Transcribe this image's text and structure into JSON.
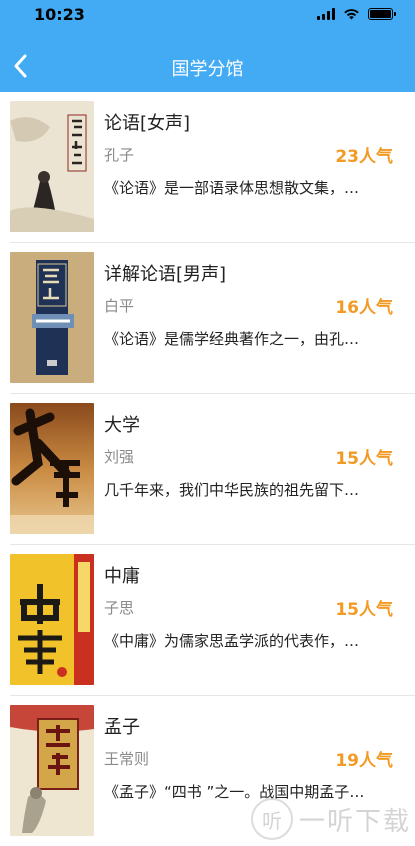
{
  "status_bar": {
    "time": "10:23"
  },
  "nav": {
    "title": "国学分馆",
    "back_icon": "chevron-left-icon"
  },
  "colors": {
    "header": "#42abf3",
    "popularity": "#f39a24",
    "author": "#8a8a8a"
  },
  "books": [
    {
      "title": "论语[女声]",
      "author": "孔子",
      "popularity": "23人气",
      "description": "《论语》是一部语录体思想散文集，主要记载孔子及其弟子的言行"
    },
    {
      "title": "详解论语[男声]",
      "author": "白平",
      "popularity": "16人气",
      "description": "《论语》是儒学经典著作之一，由孔子的弟子及再传弟子编撰而成"
    },
    {
      "title": "大学",
      "author": "刘强",
      "popularity": "15人气",
      "description": "几千年来，我们中华民族的祖先留下了许多宝贵的文化遗产"
    },
    {
      "title": "中庸",
      "author": "子思",
      "popularity": "15人气",
      "description": "《中庸》为儒家思孟学派的代表作，原是《礼记》中的一篇"
    },
    {
      "title": "孟子",
      "author": "王常则",
      "popularity": "19人气",
      "description": "《孟子》“四书 ”之一。战国中期孟子及其弟子所著"
    }
  ],
  "watermark": {
    "logo_glyph": "听",
    "text": "一听下载"
  }
}
